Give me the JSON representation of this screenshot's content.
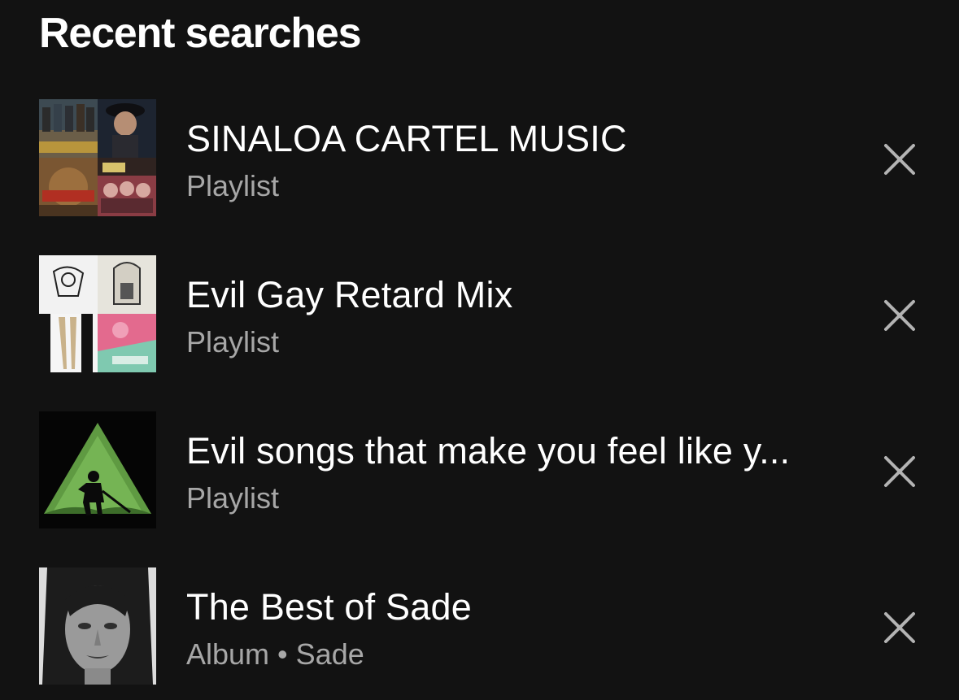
{
  "page": {
    "title": "Recent searches"
  },
  "recent_searches": [
    {
      "title": "SINALOA CARTEL MUSIC",
      "type": "Playlist",
      "cover_icon": "collage-cover"
    },
    {
      "title": "Evil Gay Retard Mix",
      "type": "Playlist",
      "cover_icon": "collage-cover"
    },
    {
      "title": "Evil songs that make you feel like y...",
      "type": "Playlist",
      "cover_icon": "silhouette-triangle-cover"
    },
    {
      "title": "The Best of Sade",
      "type": "Album",
      "separator": "•",
      "artist": "Sade",
      "cover_icon": "portrait-cover"
    }
  ],
  "colors": {
    "background": "#121212",
    "primary_text": "#ffffff",
    "secondary_text": "#a7a7a7",
    "remove_icon": "#b3b3b3"
  },
  "icons": {
    "remove": "close-icon"
  }
}
